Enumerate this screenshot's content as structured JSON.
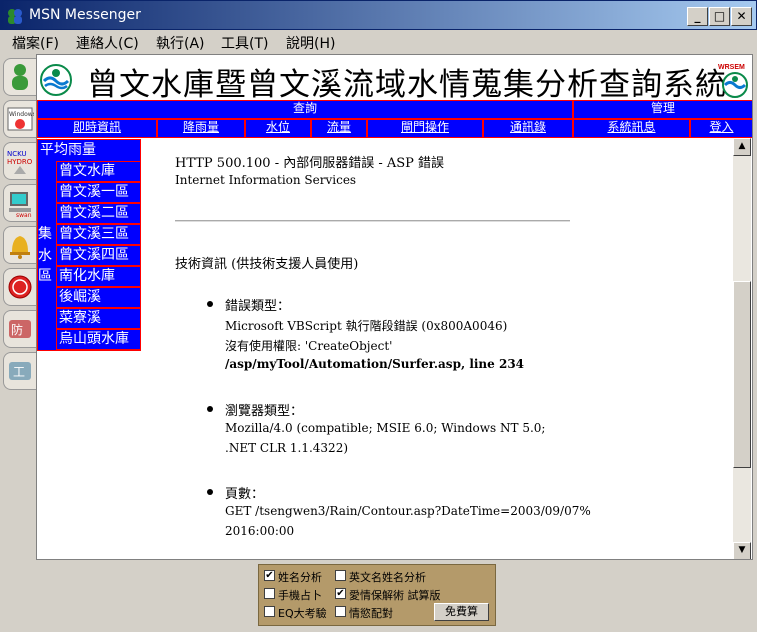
{
  "window": {
    "title": "MSN Messenger"
  },
  "menu": [
    "檔案(F)",
    "連絡人(C)",
    "執行(A)",
    "工具(T)",
    "說明(H)"
  ],
  "header": {
    "title": "曾文水庫暨曾文溪流域水情蒐集分析查詢系統"
  },
  "nav": {
    "group_query": "查詢",
    "group_admin": "管理",
    "items": [
      "即時資訊",
      "降雨量",
      "水位",
      "流量",
      "閘門操作",
      "通訊錄",
      "系統訊息",
      "登入"
    ]
  },
  "leftnav": {
    "title": "平均雨量",
    "vertical": [
      "集",
      "水",
      "區"
    ],
    "items": [
      "曾文水庫",
      "曾文溪一區",
      "曾文溪二區",
      "曾文溪三區",
      "曾文溪四區",
      "南化水庫",
      "後崛溪",
      "菜寮溪",
      "烏山頭水庫"
    ]
  },
  "error": {
    "title": "HTTP 500.100 - 內部伺服器錯誤 - ASP 錯誤",
    "subtitle": "Internet Information Services",
    "tech_info": "技術資訊 (供技術支援人員使用)",
    "sections": [
      {
        "label": "錯誤類型：",
        "lines": [
          "Microsoft VBScript 執行階段錯誤 (0x800A0046)",
          "沒有使用權限: 'CreateObject'"
        ],
        "bold": "/asp/myTool/Automation/Surfer.asp, line 234"
      },
      {
        "label": "瀏覽器類型：",
        "lines": [
          "Mozilla/4.0 (compatible; MSIE 6.0; Windows NT 5.0;",
          ".NET CLR 1.1.4322)"
        ]
      },
      {
        "label": "頁數：",
        "lines": [
          "GET /tsengwen3/Rain/Contour.asp?DateTime=2003/09/07%",
          "2016:00:00"
        ]
      }
    ]
  },
  "ad": {
    "options": [
      "姓名分析",
      "英文名姓名分析",
      "手機占卜",
      "愛情保解術 試算版",
      "EQ大考驗",
      "情慾配對"
    ],
    "checked": [
      true,
      false,
      false,
      true,
      false,
      false
    ],
    "button": "免費算"
  },
  "colors": {
    "nav_bg": "#0000ff",
    "nav_border": "#ff0000",
    "titlebar": "#0a246a"
  }
}
